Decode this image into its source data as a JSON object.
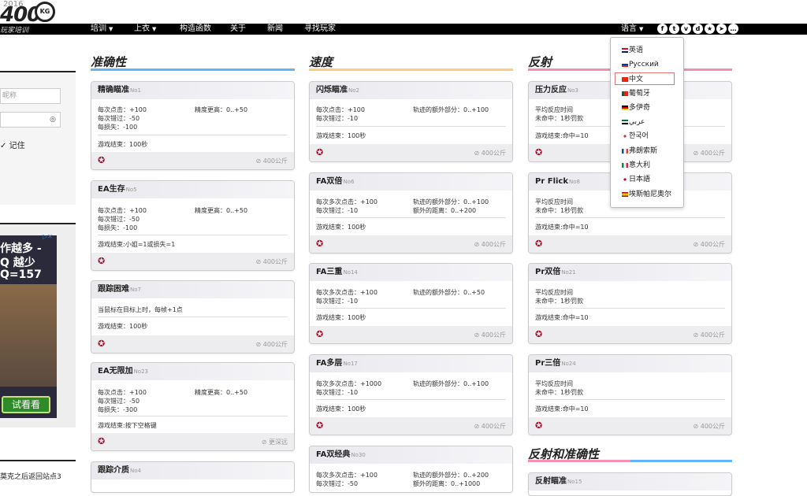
{
  "logo": {
    "sup": "2016",
    "text": "400",
    "circle": "KG"
  },
  "nav": {
    "tagline": "玩家培训",
    "items": [
      "培训",
      "上衣",
      "构造函数",
      "关于",
      "新闻",
      "寻找玩家"
    ],
    "language": "语言",
    "social_icons": [
      "facebook-icon",
      "twitter-icon",
      "vk-icon",
      "discord-icon",
      "star-icon",
      "telegram-icon",
      "more-icon"
    ]
  },
  "left": {
    "nickname_placeholder": "昵称",
    "remember": "记住",
    "ad_lines": [
      "作越多 -",
      "Q 越少",
      "Q=157"
    ],
    "ad_button": "试看看",
    "bottom_text": "莫克之后返回站点3"
  },
  "columns": [
    {
      "title": "准确性",
      "accent": "#64b5f6"
    },
    {
      "title": "速度",
      "accent": "#ffcc80"
    },
    {
      "title": "反射",
      "accent": "#f48fb1"
    }
  ],
  "section4_title": "反射和准确性",
  "cards": {
    "c1": {
      "name": "精确瞄准",
      "no": "No1",
      "s1": "每次点击：+100",
      "s2": "每次错过：-50",
      "s3": "每损失：-100",
      "r1": "精度更高：0..+50",
      "end": "游戏结束：100秒",
      "dist": "⊘ 400公斤"
    },
    "c2": {
      "name": "EA生存",
      "no": "No5",
      "s1": "每次点击：+100",
      "s2": "每次错过：-50",
      "s3": "每损失：-100",
      "r1": "精度更高：0..+50",
      "end": "游戏结束:小姐=1或损失=1",
      "dist": "⊘ 400公斤"
    },
    "c3": {
      "name": "跟踪困难",
      "no": "No7",
      "s1": "当鼠标在目标上时，每帧+1点",
      "end": "游戏结束：100秒",
      "dist": "⊘ 400公斤"
    },
    "c4": {
      "name": "EA无限加",
      "no": "No23",
      "s1": "每次点击：+100",
      "s2": "每次错过：-50",
      "s3": "每损失：-300",
      "r1": "精度更高：0..+50",
      "end": "游戏结束:按下空格键",
      "dist": "⊘ 更深远"
    },
    "c5": {
      "name": "跟踪介质",
      "no": "No4"
    },
    "d1": {
      "name": "闪烁瞄准",
      "no": "No2",
      "s1": "每次点击：+100",
      "s2": "每次错过：-10",
      "r1": "轨迹的额外部分：0..+100",
      "end": "游戏结束：100秒",
      "dist": "⊘ 400公斤"
    },
    "d2": {
      "name": "FA双倍",
      "no": "No6",
      "s1": "每次多次点击：+100",
      "s2": "每次错过：-10",
      "r1": "轨迹的额外部分：0..+100",
      "r2": "额外的距离：0..+200",
      "end": "游戏结束：100秒",
      "dist": "⊘ 400公斤"
    },
    "d3": {
      "name": "FA三重",
      "no": "No14",
      "s1": "每次多次点击：+100",
      "s2": "每次错过：-10",
      "r1": "轨迹的额外部分：0..+50",
      "end": "游戏结束：100秒",
      "dist": "⊘ 400公斤"
    },
    "d4": {
      "name": "FA多层",
      "no": "No17",
      "s1": "每次多次点击：+1000",
      "s2": "每次错过：-10",
      "r1": "轨迹的额外部分：0..+100",
      "end": "游戏结束：100秒",
      "dist": "⊘ 400公斤"
    },
    "d5": {
      "name": "FA双经典",
      "no": "No30",
      "s1": "每次多次点击：+100",
      "s2": "每次错过：-50",
      "r1": "轨迹的额外部分：0..+200",
      "r2": "额外的距离：0..+1000"
    },
    "e1": {
      "name": "压力反应",
      "no": "No3",
      "s1": "平均反应时间",
      "s2": "未命中：1秒罚款",
      "end": "游戏结束:命中=10",
      "dist": "⊘ 400公斤"
    },
    "e2": {
      "name": "Pr Flick",
      "no": "No8",
      "s1": "平均反应时间",
      "s2": "未命中：1秒罚款",
      "end": "游戏结束:命中=10",
      "dist": "⊘ 400公斤"
    },
    "e3": {
      "name": "Pr双倍",
      "no": "No21",
      "s1": "平均反应时间",
      "s2": "未命中：1秒罚款",
      "end": "游戏结束:命中=10",
      "dist": "⊘ 400公斤"
    },
    "e4": {
      "name": "Pr三倍",
      "no": "No24",
      "s1": "平均反应时间",
      "s2": "未命中：1秒罚款",
      "end": "游戏结束:命中=10",
      "dist": "⊘ 400公斤"
    },
    "e5": {
      "name": "反射瞄准",
      "no": "No15"
    }
  },
  "languages": [
    "英语",
    "Русский",
    "中文",
    "葡萄牙",
    "多伊奇",
    "عربي",
    "한국어",
    "弗朗索斯",
    "意大利",
    "日本語",
    "埃斯帕尼奥尔"
  ],
  "selected_language": "中文"
}
